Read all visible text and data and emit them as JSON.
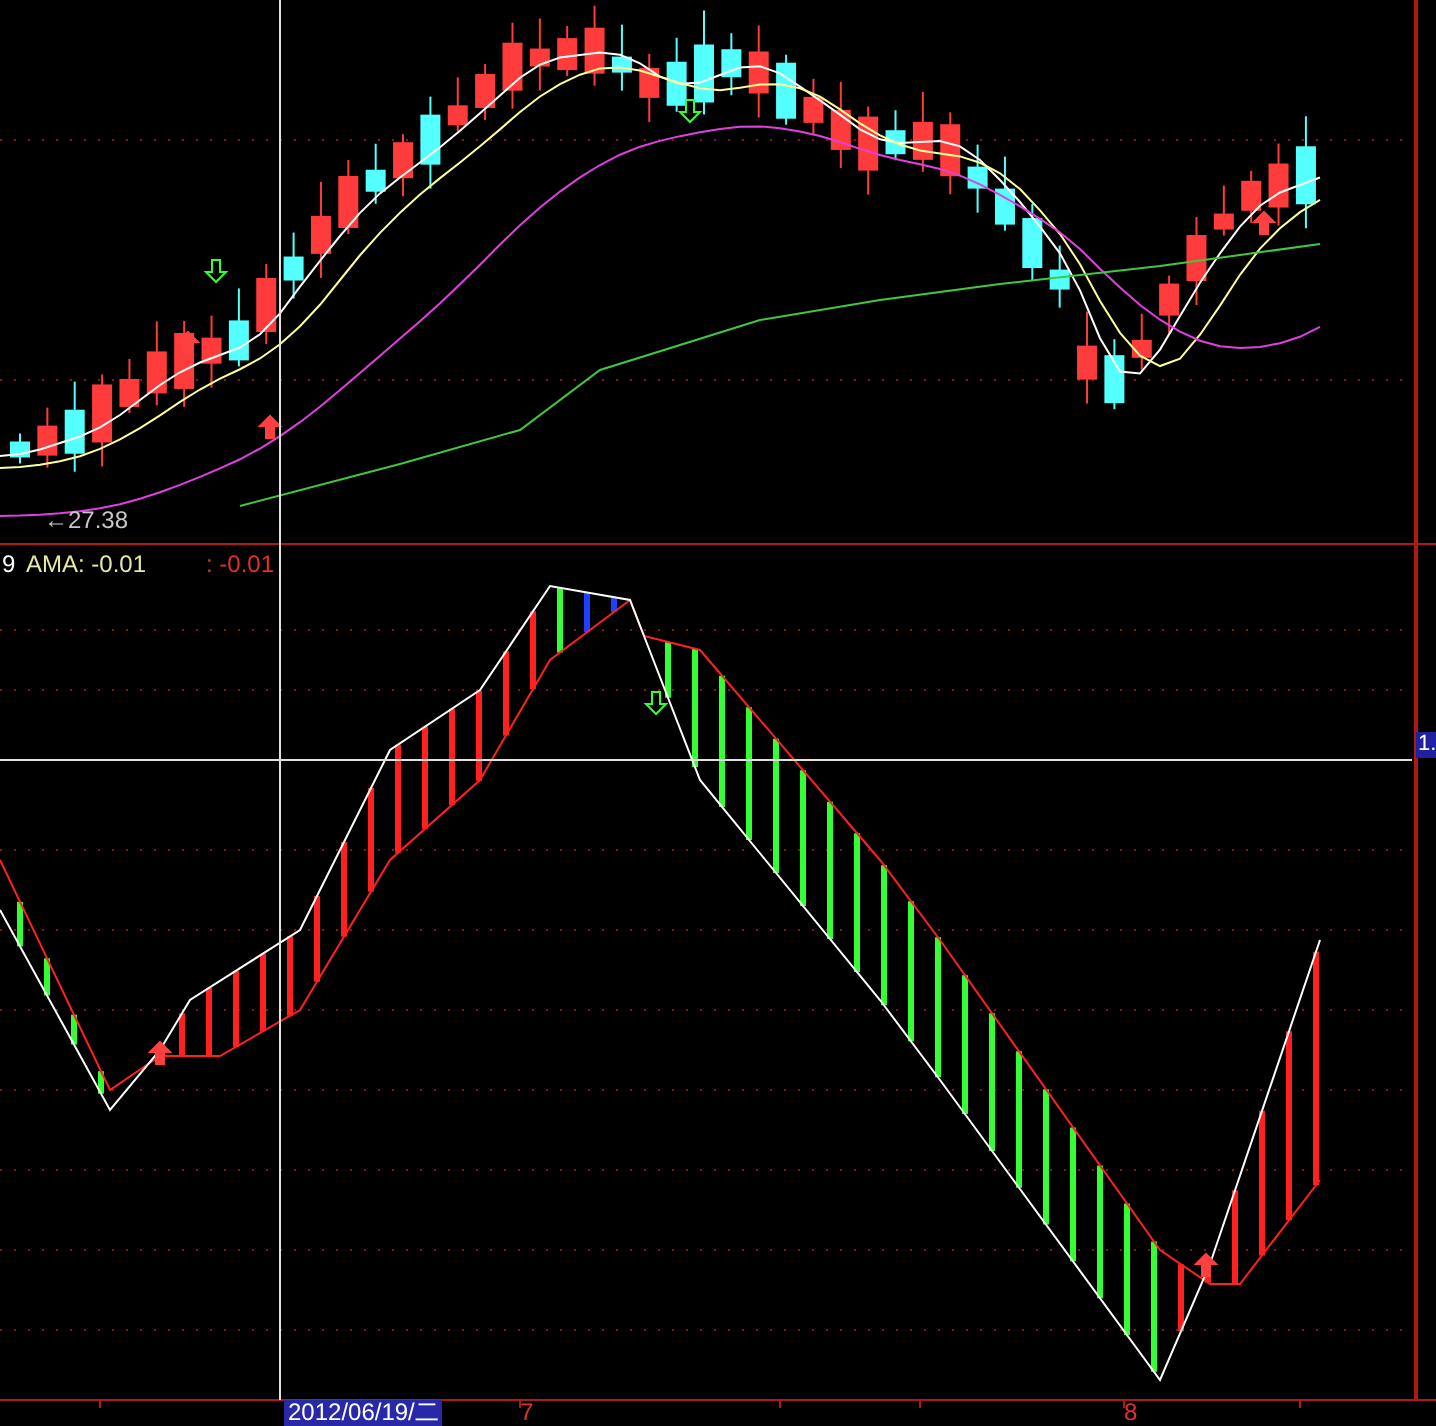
{
  "price_panel": {
    "low_label": "←27.38"
  },
  "indicator_panel": {
    "period": "9",
    "ama_label": "AMA: -0.01",
    "value_label": ": -0.01",
    "crosshair_value": "1."
  },
  "time_axis": {
    "crosshair_date": "2012/06/19/二",
    "ticks": [
      "7",
      "8"
    ]
  }
}
